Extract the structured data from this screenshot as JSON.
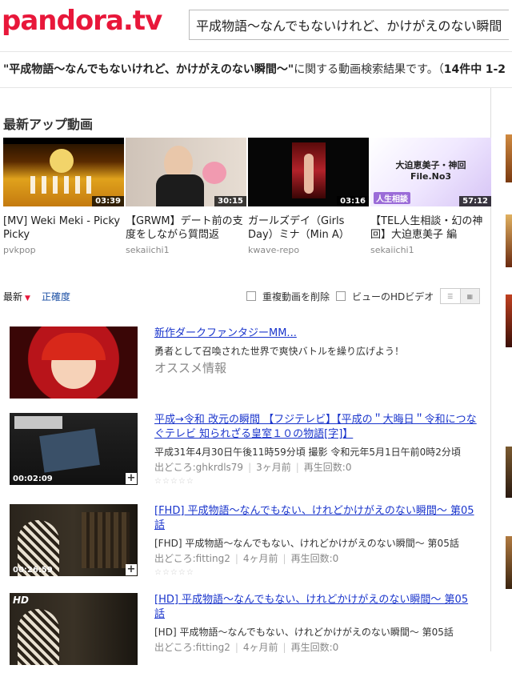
{
  "header": {
    "logo": "pandora.tv",
    "search_value": "平成物語～なんでもないけれど、かけがえのない瞬間～"
  },
  "result": {
    "query": "\"平成物語～なんでもないけれど、かけがえのない瞬間～\"",
    "suffix": "に関する動画検索結果です。（",
    "count": "14件中",
    "range": "1-2"
  },
  "latest": {
    "title": "最新アップ動画",
    "items": [
      {
        "title": "[MV] Weki Meki - Picky Picky",
        "user": "pvkpop",
        "duration": "03:39"
      },
      {
        "title": "【GRWM】デート前の支度をしながら質問返",
        "user": "sekaiichi1",
        "duration": "30:15"
      },
      {
        "title": "ガールズデイ（Girls Day）ミナ（Min A）",
        "user": "kwave-repo",
        "duration": "03:16"
      },
      {
        "title": "【TEL人生相談・幻の神回】大迫恵美子 編",
        "user": "sekaiichi1",
        "duration": "57:12",
        "thumb_text_1": "大迫恵美子・神回",
        "thumb_text_2": "File.No3",
        "thumb_badge": "人生相談"
      }
    ]
  },
  "sort": {
    "latest": "最新",
    "accuracy": "正確度",
    "dedupe": "重複動画を削除",
    "hd": "ビューのHDビデオ"
  },
  "results": [
    {
      "title": "新作ダークファンタジーMM...",
      "desc": "勇者として召喚された世界で爽快バトルを繰り広げよう！",
      "tag": "オススメ情報"
    },
    {
      "title": "平成→令和 改元の瞬間 【フジテレビ】【平成の＂大晦日＂令和につなぐテレビ 知られざる皇室１０の物語[字]】",
      "desc": "平成31年4月30日午後11時59分頃 撮影 令和元年5月1日午前0時2分頃",
      "source": "出どころ:ghkrdls79",
      "ago": "3ヶ月前",
      "views": "再生回数:0",
      "duration": "00:02:09"
    },
    {
      "title": "[FHD] 平成物語～なんでもない、けれどかけがえのない瞬間～ 第05話",
      "desc": "[FHD] 平成物語～なんでもない、けれどかけがえのない瞬間～ 第05話",
      "source": "出どころ:fitting2",
      "ago": "4ヶ月前",
      "views": "再生回数:0",
      "duration": "00:26:59"
    },
    {
      "title": "[HD] 平成物語～なんでもない、けれどかけがえのない瞬間～ 第05話",
      "desc": "[HD] 平成物語～なんでもない、けれどかけがえのない瞬間～ 第05話",
      "source": "出どころ:fitting2",
      "ago": "4ヶ月前",
      "views": "再生回数:0",
      "badge": "HD"
    }
  ],
  "colors": {
    "brand": "#e8173a",
    "link": "#1a35cc"
  }
}
